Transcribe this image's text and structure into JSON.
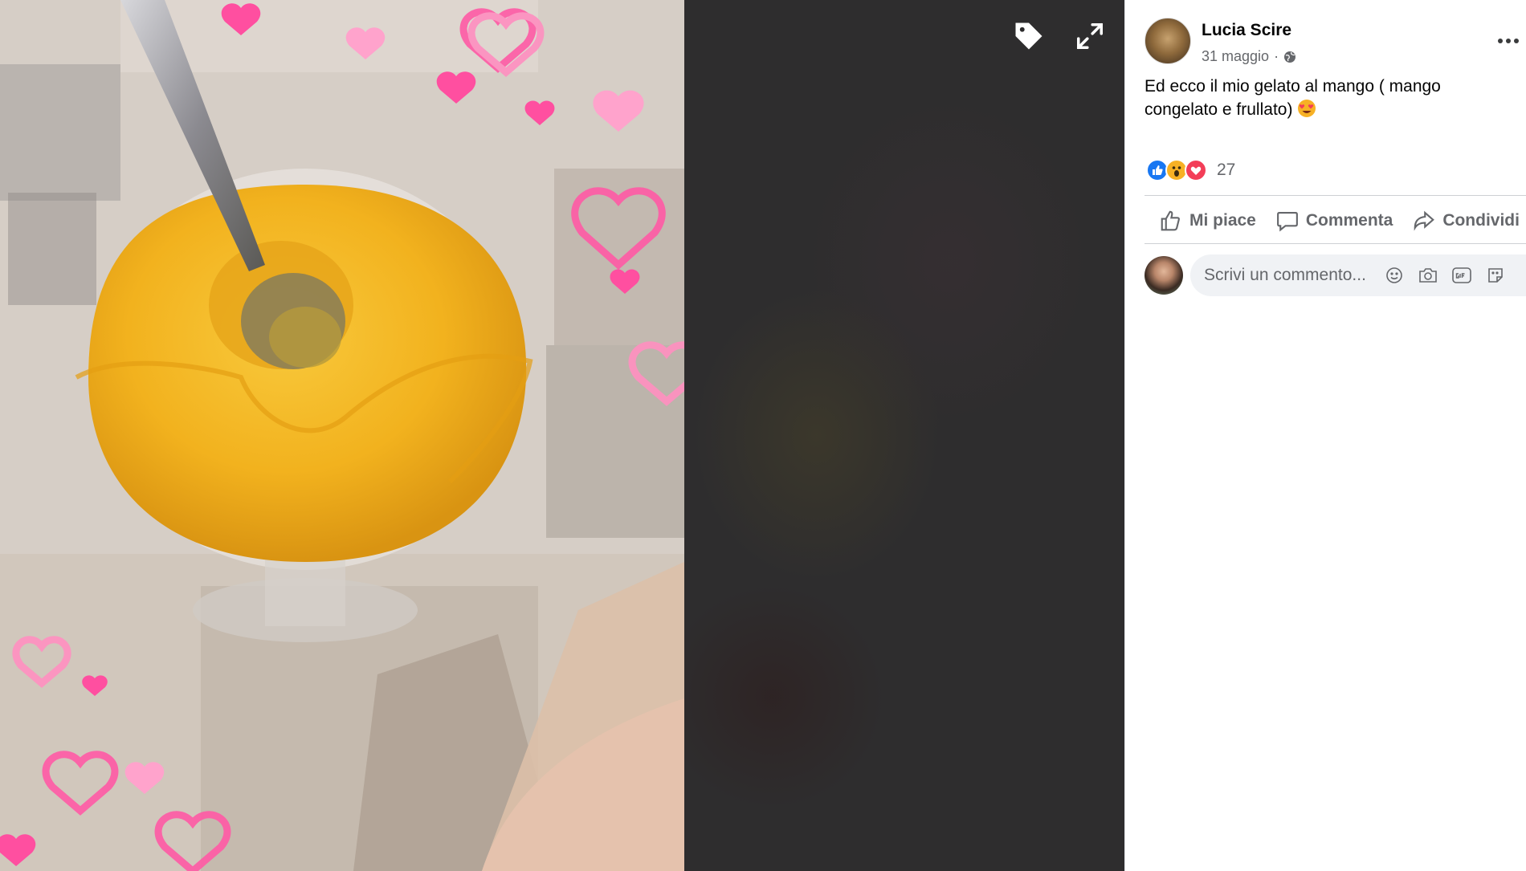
{
  "viewer": {
    "tag_button_icon": "tag-icon",
    "fullscreen_button_icon": "expand-icon"
  },
  "post": {
    "author": "Lucia Scire",
    "date": "31 maggio",
    "separator": "·",
    "privacy_icon": "globe-icon",
    "text_line1": "Ed ecco il mio gelato al mango ( mango",
    "text_line2": "congelato e frullato)",
    "text_emoji": "heart-eyes-emoji",
    "reaction_icons": [
      "like-icon",
      "wow-icon",
      "love-icon"
    ],
    "reaction_count": "27"
  },
  "actions": {
    "like_label": "Mi piace",
    "comment_label": "Commenta",
    "share_label": "Condividi"
  },
  "comment": {
    "placeholder": "Scrivi un commento..."
  },
  "colors": {
    "like_blue": "#1877f2",
    "love_red": "#f33e58",
    "wow_yellow": "#f7b125",
    "text_secondary": "#65676b"
  }
}
